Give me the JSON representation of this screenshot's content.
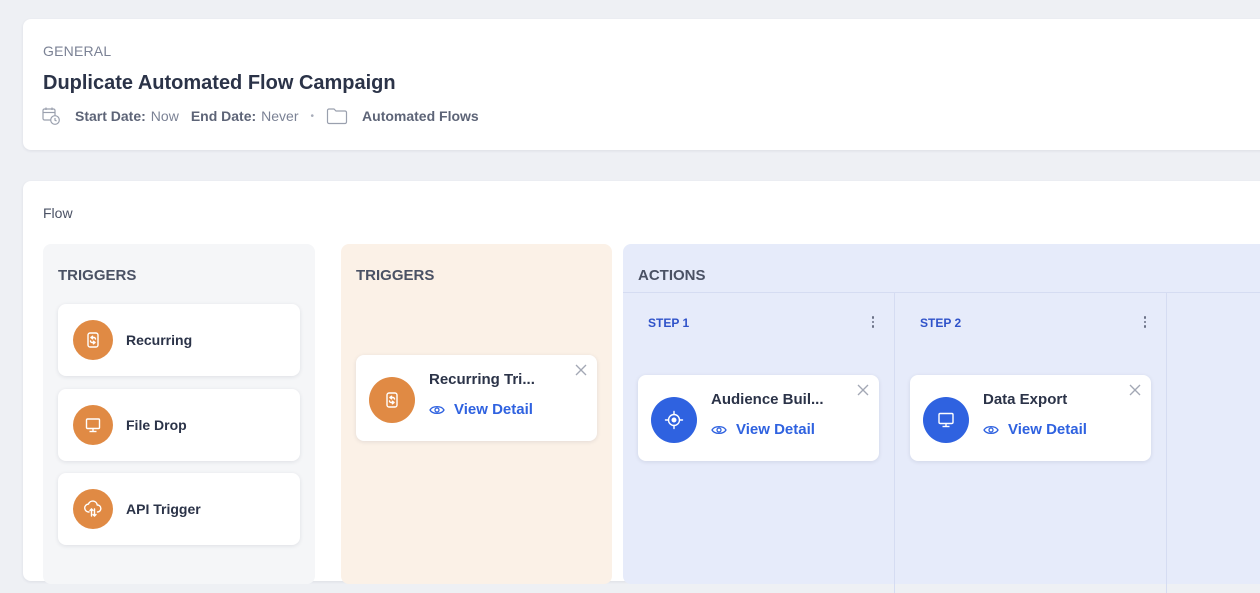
{
  "general": {
    "section_label": "GENERAL",
    "title": "Duplicate Automated Flow Campaign",
    "start_date_label": "Start Date:",
    "start_date_value": "Now",
    "end_date_label": "End Date:",
    "end_date_value": "Never",
    "separator": "•",
    "folder_name": "Automated Flows",
    "icons": [
      "calendar-clock-icon",
      "folder-icon"
    ]
  },
  "flow": {
    "label": "Flow",
    "library": {
      "heading": "TRIGGERS",
      "items": [
        {
          "label": "Recurring",
          "icon": "recurring-icon"
        },
        {
          "label": "File Drop",
          "icon": "file-drop-icon"
        },
        {
          "label": "API Trigger",
          "icon": "api-trigger-icon"
        }
      ]
    },
    "trigger_column": {
      "heading": "TRIGGERS",
      "node": {
        "title": "Recurring Tri...",
        "action": "View Detail",
        "icon": "recurring-icon"
      }
    },
    "actions_column": {
      "heading": "ACTIONS",
      "steps": [
        {
          "label": "STEP 1",
          "node": {
            "title": "Audience Buil...",
            "action": "View Detail",
            "icon": "target-icon"
          }
        },
        {
          "label": "STEP 2",
          "node": {
            "title": "Data Export",
            "action": "View Detail",
            "icon": "folder-icon"
          }
        }
      ]
    }
  },
  "colors": {
    "accent_blue": "#2f62e0",
    "accent_orange": "#e08a44",
    "trigger_bg": "#fbf1e7",
    "actions_bg": "#e6ebfa"
  }
}
